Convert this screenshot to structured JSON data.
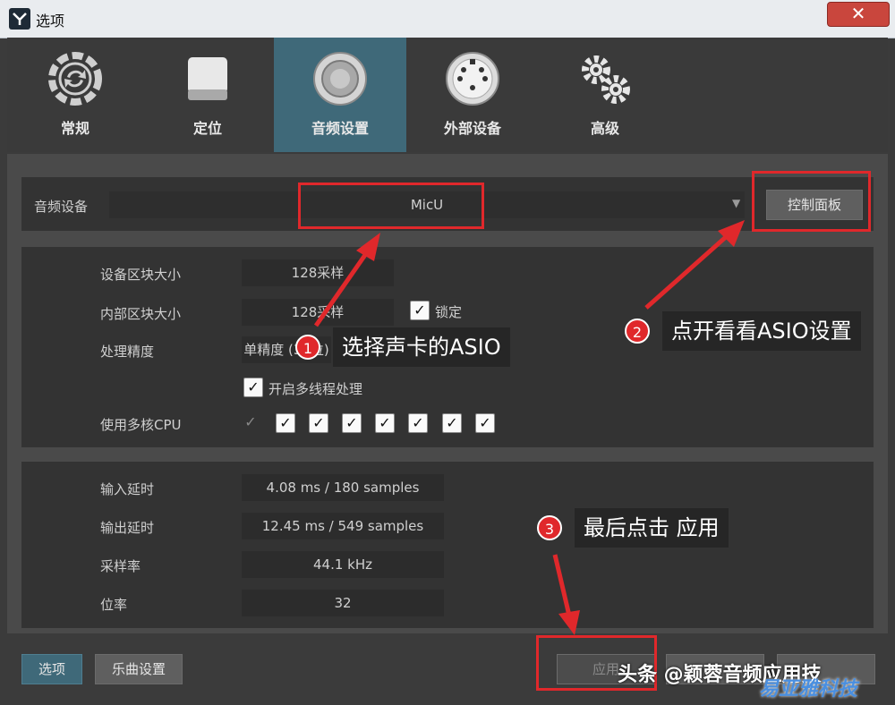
{
  "window": {
    "title": "选项",
    "close_glyph": "✕"
  },
  "tabs": [
    {
      "label": "常规",
      "icon": "sync-icon",
      "active": false
    },
    {
      "label": "定位",
      "icon": "drive-icon",
      "active": false
    },
    {
      "label": "音频设置",
      "icon": "speaker-icon",
      "active": true
    },
    {
      "label": "外部设备",
      "icon": "midi-port-icon",
      "active": false
    },
    {
      "label": "高级",
      "icon": "gears-icon",
      "active": false
    }
  ],
  "audio_device": {
    "label": "音频设备",
    "value": "MicU",
    "control_panel": "控制面板"
  },
  "settings": {
    "device_block_label": "设备区块大小",
    "device_block_value": "128采样",
    "internal_block_label": "内部区块大小",
    "internal_block_value": "128采样",
    "lock_label": "锁定",
    "precision_label": "处理精度",
    "precision_value": "单精度 (32位)",
    "multithread_label": "开启多线程处理",
    "multicore_label": "使用多核CPU"
  },
  "info": {
    "input_latency_label": "输入延时",
    "input_latency_value": "4.08 ms / 180 samples",
    "output_latency_label": "输出延时",
    "output_latency_value": "12.45 ms / 549 samples",
    "sample_rate_label": "采样率",
    "sample_rate_value": "44.1 kHz",
    "bit_depth_label": "位率",
    "bit_depth_value": "32"
  },
  "footer": {
    "options": "选项",
    "song_settings": "乐曲设置",
    "apply": "应用"
  },
  "annotations": {
    "step1_num": "1",
    "step1_text": "选择声卡的ASIO",
    "step2_num": "2",
    "step2_text": "点开看看ASIO设置",
    "step3_num": "3",
    "step3_text": "最后点击 应用"
  },
  "watermarks": {
    "wm1": "头条 @颖蓉音频应用技",
    "wm2": "易亚雅科技"
  },
  "colors": {
    "active_tab": "#3f6979",
    "annotation_red": "#e0282b"
  }
}
